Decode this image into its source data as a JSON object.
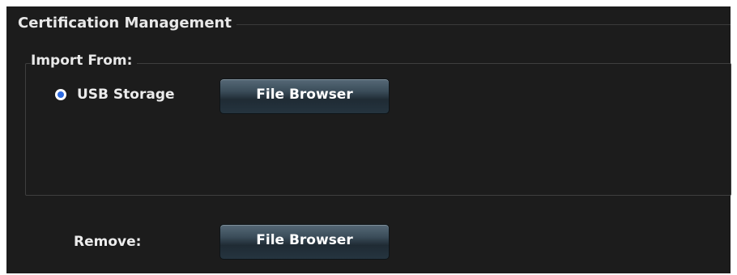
{
  "certification_management": {
    "title": "Certification Management",
    "import": {
      "title": "Import From:",
      "source_option": {
        "label": "USB Storage",
        "selected": true
      },
      "browse_button_label": "File Browser"
    },
    "remove": {
      "label": "Remove:",
      "browse_button_label": "File Browser"
    }
  },
  "colors": {
    "panel_background": "#1c1c1c",
    "radio_selected": "#2d6ae0",
    "text": "#ececec"
  }
}
